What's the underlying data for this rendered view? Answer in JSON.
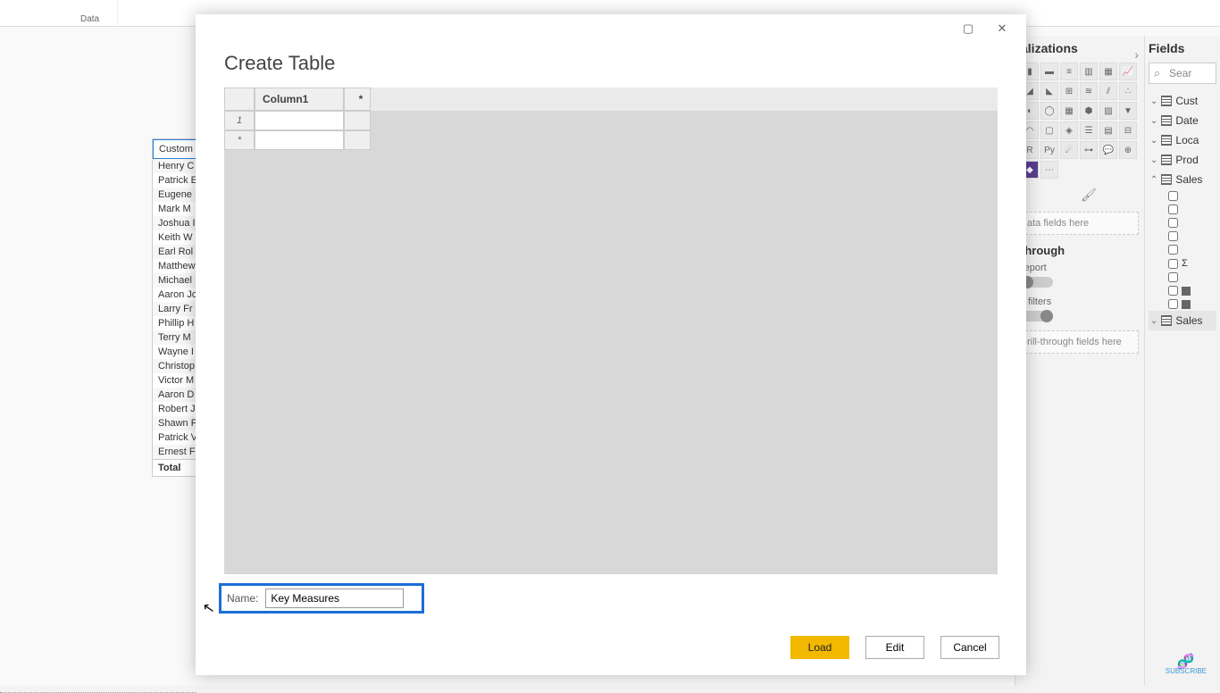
{
  "ribbon": {
    "group_data": "Data"
  },
  "visual_data": {
    "header": "Custom",
    "rows": [
      "Henry C",
      "Patrick E",
      "Eugene",
      "Mark M",
      "Joshua I",
      "Keith W",
      "Earl Rol",
      "Matthew",
      "Michael",
      "Aaron Jo",
      "Larry Fr",
      "Phillip H",
      "Terry M",
      "Wayne I",
      "Christop",
      "Victor M",
      "Aaron D",
      "Robert J",
      "Shawn F",
      "Patrick V",
      "Ernest F"
    ],
    "total": "Total"
  },
  "viz_pane": {
    "title": "alizations",
    "data_fields_hint": "ata fields here",
    "drill_title": "through",
    "drill_report": "report",
    "drill_filters": "ll filters",
    "drill_drop": "rill-through fields here"
  },
  "fields_pane": {
    "title": "Fields",
    "search_placeholder": "Sear",
    "tables": [
      {
        "name": "Cust",
        "expanded": false
      },
      {
        "name": "Date",
        "expanded": false
      },
      {
        "name": "Loca",
        "expanded": false
      },
      {
        "name": "Prod",
        "expanded": false
      },
      {
        "name": "Sales",
        "expanded": true
      }
    ],
    "fields": [
      {
        "kind": "blank"
      },
      {
        "kind": "blank"
      },
      {
        "kind": "blank"
      },
      {
        "kind": "blank"
      },
      {
        "kind": "blank"
      },
      {
        "kind": "sigma"
      },
      {
        "kind": "blank"
      },
      {
        "kind": "calc"
      },
      {
        "kind": "calc"
      }
    ],
    "tables_more": [
      {
        "name": "Sales",
        "expanded": false,
        "highlighted": true
      }
    ]
  },
  "modal": {
    "title": "Create Table",
    "column_header": "Column1",
    "name_label": "Name:",
    "name_value": "Key Measures",
    "buttons": {
      "load": "Load",
      "edit": "Edit",
      "cancel": "Cancel"
    }
  },
  "subscribe": "SUBSCRIBE"
}
